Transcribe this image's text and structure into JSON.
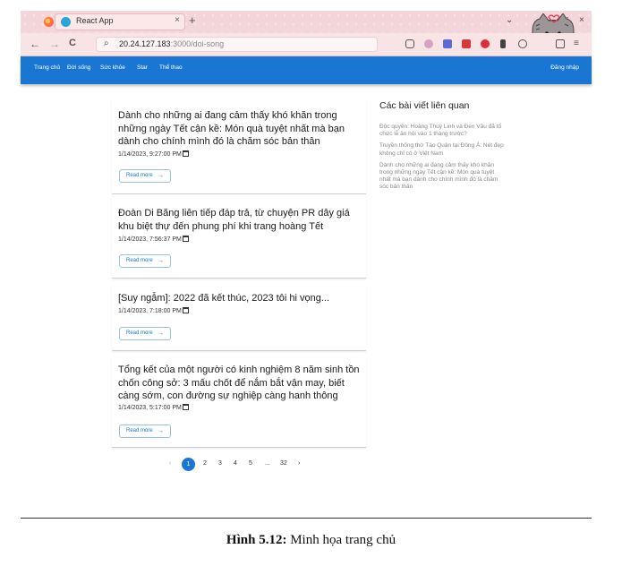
{
  "browser": {
    "tab_title": "React App",
    "tab_close": "×",
    "new_tab": "+",
    "url_host": "20.24.127.183",
    "url_path": ":3000/doi-song",
    "back": "←",
    "forward": "→",
    "reload": "C",
    "window_controls": [
      "⌄",
      "—",
      "□",
      "×"
    ]
  },
  "appbar": {
    "nav": [
      "Trang chủ",
      "Đời sống",
      "Sức khỏe",
      "Star",
      "Thể thao"
    ],
    "login": "Đăng nhập"
  },
  "posts": [
    {
      "title": "Dành cho những ai đang cảm thấy khó khăn trong những ngày Tết cận kề: Món quà tuyệt nhất mà bạn dành cho chính mình đó là chăm sóc bản thân",
      "date": "1/14/2023, 9:27:00 PM",
      "read_more": "Read more"
    },
    {
      "title": "Đoàn Di Băng liên tiếp đáp trả, từ chuyện PR dây giá khu biệt thự đến phung phí khi trang hoàng Tết",
      "date": "1/14/2023, 7:56:37 PM",
      "read_more": "Read more"
    },
    {
      "title": "[Suy ngẫm]: 2022 đã kết thúc, 2023 tôi hi vọng...",
      "date": "1/14/2023, 7:18:00 PM",
      "read_more": "Read more"
    },
    {
      "title": "Tổng kết của một người có kinh nghiệm 8 năm sinh tồn chốn công sở: 3 mấu chốt để nắm bắt vận may, biết càng sớm, con đường sự nghiệp càng hanh thông",
      "date": "1/14/2023, 5:17:00 PM",
      "read_more": "Read more"
    }
  ],
  "sidebar": {
    "title": "Các bài viết liên quan",
    "items": [
      "Độc quyền: Hoàng Thuỳ Linh và Đen Vâu đã tổ chức lễ ăn hỏi vào 1 tháng trước?",
      "Truyền thống thờ Táo Quân tại Đông Á: Nét đẹp không chỉ có ở Việt Nam",
      "Dành cho những ai đang cảm thấy khó khăn trong những ngày Tết cận kề: Món quà tuyệt nhất mà bạn dành cho chính mình đó là chăm sóc bản thân"
    ]
  },
  "pagination": {
    "prev": "‹",
    "active": "1",
    "pages": [
      "2",
      "3",
      "4",
      "5"
    ],
    "ellipsis": "...",
    "last": "32",
    "next": "›"
  },
  "caption": {
    "label": "Hình 5.12:",
    "text": "Minh họa trang chủ"
  }
}
